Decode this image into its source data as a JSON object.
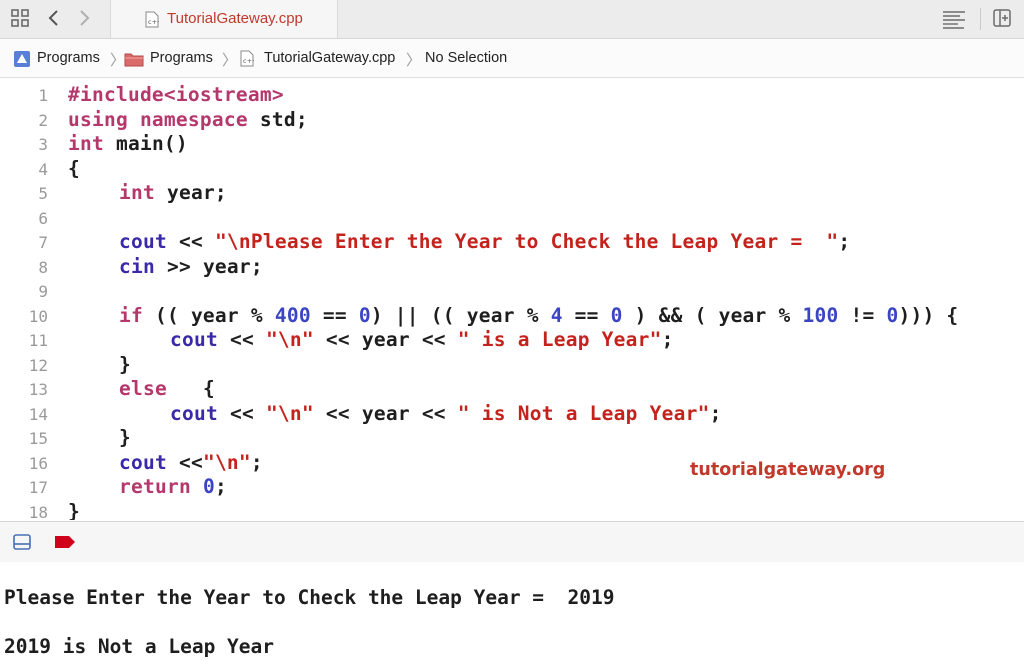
{
  "tab": {
    "title": "TutorialGateway.cpp"
  },
  "breadcrumb": {
    "items": [
      "Programs",
      "Programs",
      "TutorialGateway.cpp",
      "No Selection"
    ]
  },
  "icons": {
    "grid": "grid-icon",
    "back": "chevron-left-icon",
    "forward": "chevron-right-icon",
    "editor_options": "lines-icon",
    "add_editor": "add-editor-icon",
    "project": "project-icon",
    "folder": "folder-icon",
    "cpp_file": "cpp-file-icon",
    "hide_debug": "panel-toggle-icon",
    "breakpoint": "breakpoint-icon"
  },
  "colors": {
    "keyword": "#b5386d",
    "string": "#c4231d",
    "number": "#3b45c4",
    "identifier": "#3a2aa8",
    "line_number": "#9a9a9a",
    "tab_title": "#c03a2b",
    "breakpoint": "#d0021b"
  },
  "editor": {
    "line_numbers": [
      "1",
      "2",
      "3",
      "4",
      "5",
      "6",
      "7",
      "8",
      "9",
      "10",
      "11",
      "12",
      "13",
      "14",
      "15",
      "16",
      "17",
      "18"
    ],
    "lines": [
      {
        "t": "#include<iostream>"
      },
      {
        "a": "using namespace",
        "b": " std;"
      },
      {
        "a": "int",
        "b": " main()"
      },
      {
        "t": "{"
      },
      {
        "a": "int",
        "b": " year;"
      },
      {
        "t": ""
      },
      {
        "c": "cout",
        "d": " << ",
        "s": "\"\\nPlease Enter the Year to Check the Leap Year =  \"",
        "e": ";"
      },
      {
        "c": "cin",
        "d": " >> year;"
      },
      {
        "t": ""
      },
      {
        "a": "if",
        "p1": " (( year % ",
        "n1": "400",
        "p2": " == ",
        "n2": "0",
        "p3": ") || (( year % ",
        "n3": "4",
        "p4": " == ",
        "n4": "0",
        "p5": " ) && ( year % ",
        "n5": "100",
        "p6": " != ",
        "n6": "0",
        "p7": "))) {"
      },
      {
        "c": "cout",
        "d": " << ",
        "s1": "\"\\n\"",
        "m": " << year << ",
        "s": "\" is a Leap Year\"",
        "e": ";"
      },
      {
        "t": "}"
      },
      {
        "a": "else",
        "b": "   {"
      },
      {
        "c": "cout",
        "d": " << ",
        "s1": "\"\\n\"",
        "m": " << year << ",
        "s": "\" is Not a Leap Year\"",
        "e": ";"
      },
      {
        "t": "}"
      },
      {
        "c": "cout",
        "d": " <<",
        "s": "\"\\n\"",
        "e": ";"
      },
      {
        "a": "return",
        "b": " ",
        "n": "0",
        "e": ";"
      },
      {
        "t": "}"
      }
    ]
  },
  "watermark": "tutorialgateway.org",
  "console": {
    "lines": [
      "Please Enter the Year to Check the Leap Year =  2019",
      "2019 is Not a Leap Year"
    ]
  }
}
